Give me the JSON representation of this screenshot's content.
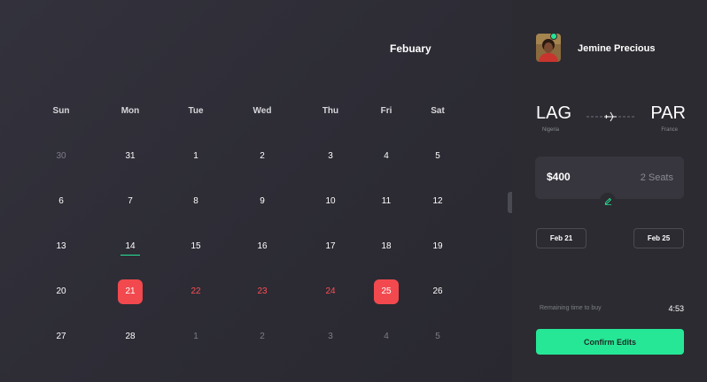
{
  "calendar": {
    "month": "Febuary",
    "weekdays": [
      "Sun",
      "Mon",
      "Tue",
      "Wed",
      "Thu",
      "Fri",
      "Sat"
    ],
    "weeks": [
      [
        {
          "day": "30",
          "state": "muted"
        },
        {
          "day": "31",
          "state": "normal"
        },
        {
          "day": "1",
          "state": "normal"
        },
        {
          "day": "2",
          "state": "normal"
        },
        {
          "day": "3",
          "state": "normal"
        },
        {
          "day": "4",
          "state": "normal"
        },
        {
          "day": "5",
          "state": "normal"
        }
      ],
      [
        {
          "day": "6",
          "state": "normal"
        },
        {
          "day": "7",
          "state": "normal"
        },
        {
          "day": "8",
          "state": "normal"
        },
        {
          "day": "9",
          "state": "normal"
        },
        {
          "day": "10",
          "state": "normal"
        },
        {
          "day": "11",
          "state": "normal"
        },
        {
          "day": "12",
          "state": "normal"
        }
      ],
      [
        {
          "day": "13",
          "state": "normal"
        },
        {
          "day": "14",
          "state": "today"
        },
        {
          "day": "15",
          "state": "normal"
        },
        {
          "day": "16",
          "state": "normal"
        },
        {
          "day": "17",
          "state": "normal"
        },
        {
          "day": "18",
          "state": "normal"
        },
        {
          "day": "19",
          "state": "normal"
        }
      ],
      [
        {
          "day": "20",
          "state": "normal"
        },
        {
          "day": "21",
          "state": "selected"
        },
        {
          "day": "22",
          "state": "range"
        },
        {
          "day": "23",
          "state": "range"
        },
        {
          "day": "24",
          "state": "range"
        },
        {
          "day": "25",
          "state": "selected"
        },
        {
          "day": "26",
          "state": "normal"
        }
      ],
      [
        {
          "day": "27",
          "state": "normal"
        },
        {
          "day": "28",
          "state": "normal"
        },
        {
          "day": "1",
          "state": "muted"
        },
        {
          "day": "2",
          "state": "muted"
        },
        {
          "day": "3",
          "state": "muted"
        },
        {
          "day": "4",
          "state": "muted"
        },
        {
          "day": "5",
          "state": "muted"
        }
      ]
    ]
  },
  "user": {
    "name": "Jemine Precious",
    "status": "online",
    "avatar_icon": "user-avatar"
  },
  "trip": {
    "from_code": "LAG",
    "from_country": "Nigeria",
    "to_code": "PAR",
    "to_country": "France",
    "route_icon": "airplane-icon",
    "price": "$400",
    "seats": "2 Seats",
    "edit_icon": "pencil-icon",
    "departure": "Feb 21",
    "return": "Feb 25"
  },
  "timer": {
    "label": "Remaining time to buy",
    "value": "4:53"
  },
  "actions": {
    "confirm_label": "Confirm Edits"
  },
  "colors": {
    "accent": "#26e796",
    "selected": "#f2494e",
    "range_text": "#ff4d53",
    "background": "#2f2f37",
    "panel": "#2b2b31"
  }
}
